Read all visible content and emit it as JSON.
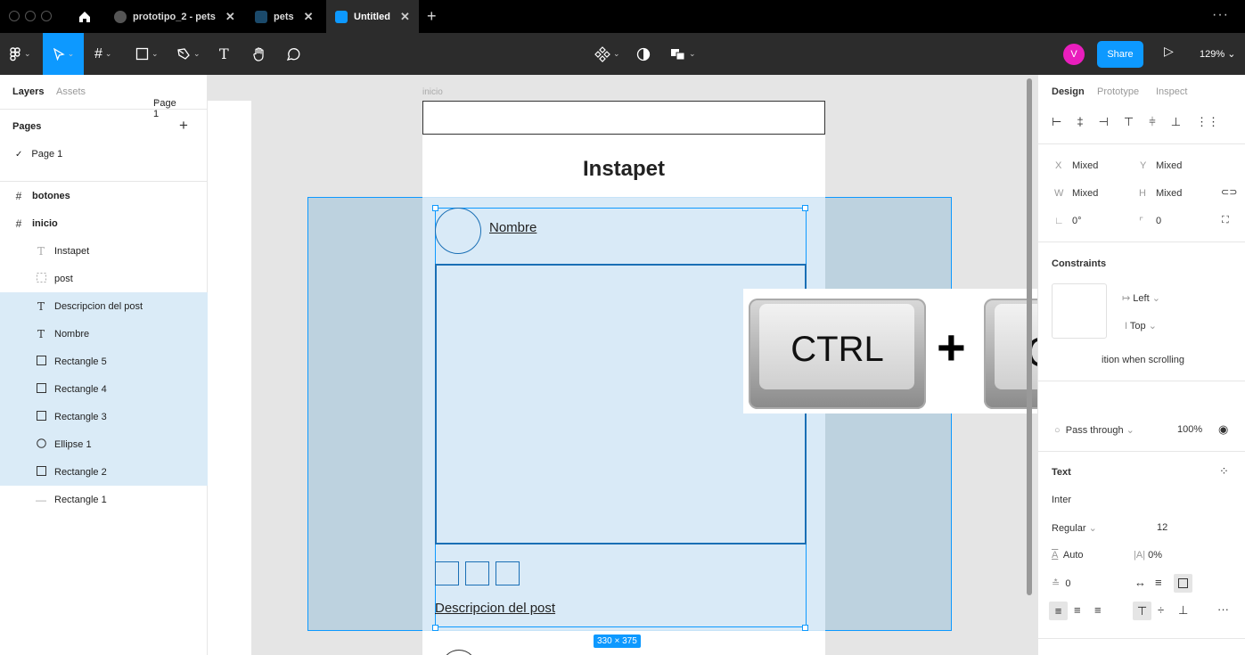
{
  "tabs": [
    {
      "label": "prototipo_2 - pets",
      "close": "✕"
    },
    {
      "label": "pets",
      "close": "✕"
    },
    {
      "label": "Untitled",
      "close": "✕"
    }
  ],
  "new_tab": "+",
  "more": "···",
  "toolbar": {
    "text_tool": "T",
    "avatar_initial": "V",
    "share_label": "Share",
    "zoom": "129%"
  },
  "left_panel": {
    "tab_layers": "Layers",
    "tab_assets": "Assets",
    "page_selector": "Page 1",
    "pages_title": "Pages",
    "add": "+",
    "pages": [
      "Page 1"
    ],
    "layers": [
      {
        "label": "botones",
        "icon": "frame-icon"
      },
      {
        "label": "inicio",
        "icon": "frame-icon"
      },
      {
        "label": "Instapet",
        "icon": "text-icon"
      },
      {
        "label": "post",
        "icon": "group-dashed-icon"
      },
      {
        "label": "Descripcion del post",
        "icon": "text-icon"
      },
      {
        "label": "Nombre",
        "icon": "text-icon"
      },
      {
        "label": "Rectangle 5",
        "icon": "rectangle-icon"
      },
      {
        "label": "Rectangle 4",
        "icon": "rectangle-icon"
      },
      {
        "label": "Rectangle 3",
        "icon": "rectangle-icon"
      },
      {
        "label": "Ellipse 1",
        "icon": "ellipse-icon"
      },
      {
        "label": "Rectangle 2",
        "icon": "rectangle-icon"
      },
      {
        "label": "Rectangle 1",
        "icon": "line-icon"
      }
    ]
  },
  "canvas": {
    "frame_label": "inicio",
    "title": "Instapet",
    "name_text": "Nombre",
    "description_text": "Descripcion del post",
    "size_badge": "330 × 375",
    "overlay": {
      "key1": "CTRL",
      "plus": "+",
      "key2": "G"
    }
  },
  "right_panel": {
    "tabs": [
      "Design",
      "Prototype",
      "Inspect"
    ],
    "x_label": "X",
    "x_value": "Mixed",
    "y_label": "Y",
    "y_value": "Mixed",
    "w_label": "W",
    "w_value": "Mixed",
    "h_label": "H",
    "h_value": "Mixed",
    "rotation": "0°",
    "radius": "0",
    "constraints_title": "Constraints",
    "constraint_h": "Left",
    "constraint_v": "Top",
    "fix_scroll": "ition when scrolling",
    "blend": "Pass through",
    "opacity": "100%",
    "text_title": "Text",
    "font": "Inter",
    "weight": "Regular",
    "size": "12",
    "line_height": "Auto",
    "letter_spacing": "0%",
    "paragraph": "0"
  },
  "colors": {
    "accent": "#0d99ff",
    "selection_fill": "#daebf7",
    "avatar": "#e91ebd"
  }
}
